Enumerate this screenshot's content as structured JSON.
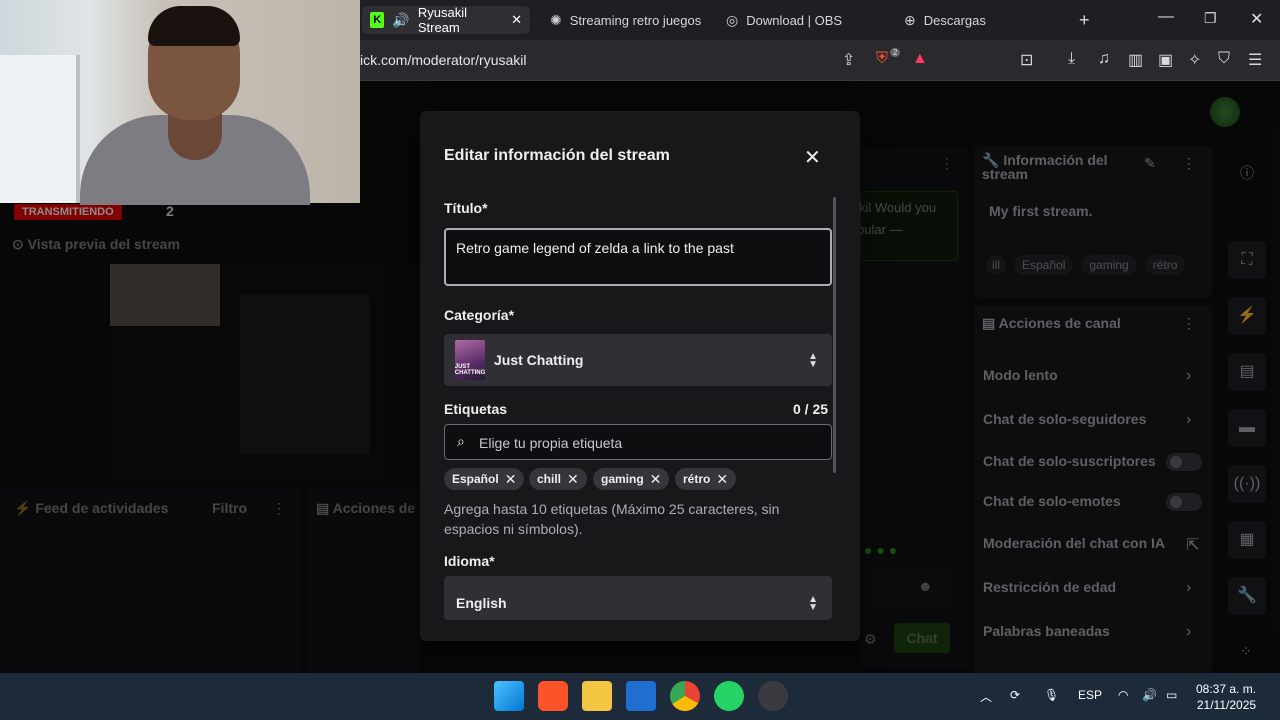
{
  "browser": {
    "tabs": [
      {
        "label": "Ryusakil Stream",
        "icon": "kick-icon",
        "active": true
      },
      {
        "label": "Streaming retro juegos",
        "icon": "chatgpt-icon"
      },
      {
        "label": "Download | OBS",
        "icon": "obs-icon"
      },
      {
        "label": "Descargas",
        "icon": "download-icon"
      }
    ],
    "url": "ick.com/moderator/ryusakil",
    "brave_badge": "2"
  },
  "background": {
    "live_badge": "TRANSMITIENDO",
    "viewer_count": "2",
    "preview_title": "Vista previa del stream",
    "activity_feed": "Feed de actividades",
    "filter_label": "Filtro",
    "actions_partial": "Acciones de",
    "chat_snippet_1": "kil Would you",
    "chat_snippet_2": "pular —",
    "chat_button": "Chat",
    "info_title": "Información del stream",
    "info_stream_title": "My first stream.",
    "info_tags": [
      "ill",
      "Español",
      "gaming",
      "rétro"
    ],
    "channel_actions_title": "Acciones de canal",
    "channel_actions": [
      {
        "label": "Modo lento",
        "kind": "chevron"
      },
      {
        "label": "Chat de solo-seguidores",
        "kind": "chevron"
      },
      {
        "label": "Chat de solo-suscriptores",
        "kind": "toggle"
      },
      {
        "label": "Chat de solo-emotes",
        "kind": "toggle"
      },
      {
        "label": "Moderación del chat con IA",
        "kind": "external"
      },
      {
        "label": "Restricción de edad",
        "kind": "chevron"
      },
      {
        "label": "Palabras baneadas",
        "kind": "chevron"
      }
    ]
  },
  "modal": {
    "title": "Editar información del stream",
    "title_label": "Título*",
    "title_value": "Retro game legend of zelda a link to the past",
    "category_label": "Categoría*",
    "category_value": "Just Chatting",
    "category_thumb_text": "JUST CHATTING",
    "tags_label": "Etiquetas",
    "tags_count": "0 / 25",
    "tags_placeholder": "Elige tu propia etiqueta",
    "tags": [
      "Español",
      "chill",
      "gaming",
      "rétro"
    ],
    "tags_help": "Agrega hasta 10 etiquetas (Máximo 25 caracteres, sin espacios ni símbolos).",
    "language_label": "Idioma*",
    "language_value": "English"
  },
  "taskbar": {
    "language": "ESP",
    "time": "08:37 a. m.",
    "date": "21/11/2025"
  },
  "colors": {
    "accent": "#53fc18",
    "live_red": "#eb0400"
  }
}
